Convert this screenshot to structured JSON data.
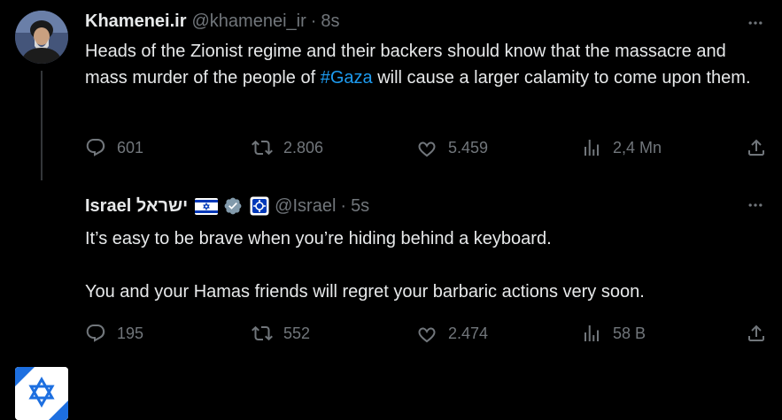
{
  "tweets": [
    {
      "display_name": "Khamenei.ir",
      "handle": "@khamenei_ir",
      "separator": "·",
      "time": "8s",
      "text_parts": {
        "before": "Heads of the Zionist regime and their backers should know that the massacre and mass murder of the people of ",
        "hashtag": "#Gaza",
        "after": " will cause a larger calamity to come upon them."
      },
      "stats": {
        "replies": "601",
        "retweets": "2.806",
        "likes": "5.459",
        "views": "2,4 Mn"
      },
      "avatar_icon": "portrait-avatar-icon"
    },
    {
      "display_name": "Israel ישראל",
      "handle": "@Israel",
      "separator": "·",
      "time": "5s",
      "paragraphs": [
        "It’s easy to be brave when you’re hiding behind a keyboard.",
        "You and your Hamas friends will regret your barbaric actions very soon."
      ],
      "stats": {
        "replies": "195",
        "retweets": "552",
        "likes": "2.474",
        "views": "58 B"
      },
      "avatar_icon": "israel-flag-avatar-icon",
      "badges": [
        "israel-flag-emoji",
        "verified-badge-icon",
        "affiliate-badge-icon"
      ]
    }
  ],
  "colors": {
    "background": "#000000",
    "text": "#e7e9ea",
    "muted": "#71767b",
    "link": "#1d9bf0",
    "thread_line": "#333639",
    "israel_blue": "#0038b8"
  }
}
